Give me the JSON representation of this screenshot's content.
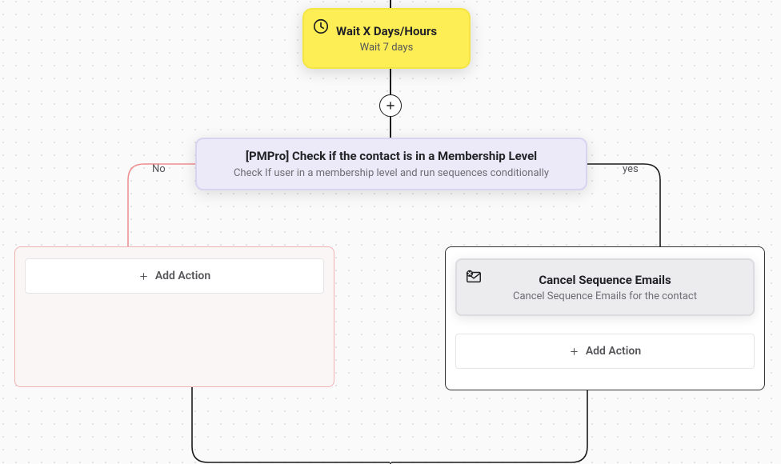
{
  "wait": {
    "title": "Wait X Days/Hours",
    "subtitle": "Wait 7 days",
    "icon_name": "clock-icon"
  },
  "condition": {
    "title": "[PMPro] Check if the contact is in a Membership Level",
    "subtitle": "Check If user in a membership level and run sequences conditionally"
  },
  "branches": {
    "no": {
      "label": "No",
      "add_action_label": "Add Action"
    },
    "yes": {
      "label": "yes",
      "add_action_label": "Add Action"
    }
  },
  "cancel_node": {
    "title": "Cancel Sequence Emails",
    "subtitle": "Cancel Sequence Emails for the contact",
    "icon_name": "cancel-mail-icon"
  },
  "connector_plus_label": "+"
}
